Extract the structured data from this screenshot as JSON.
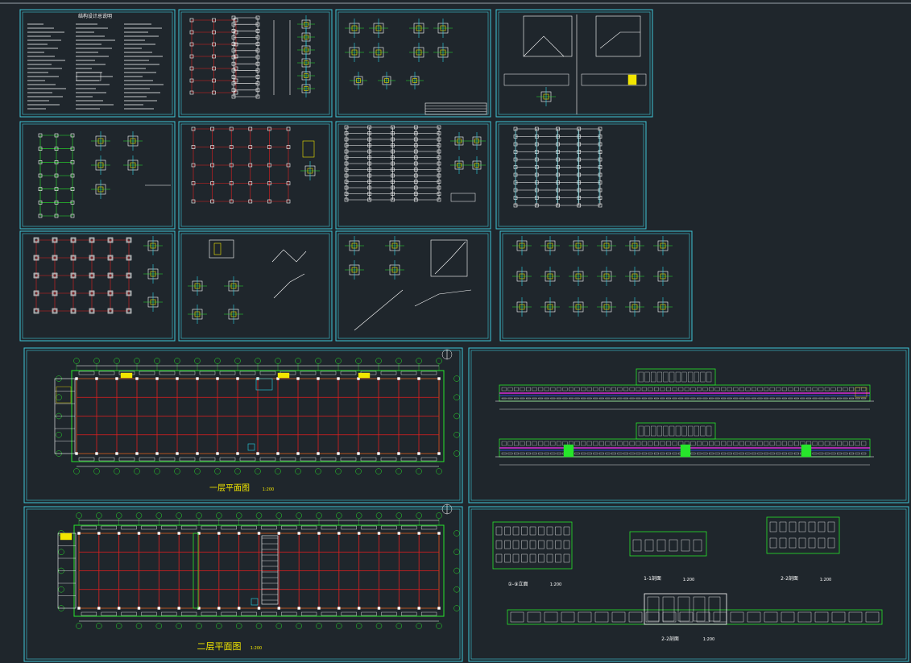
{
  "sheets": [
    {
      "id": "notes",
      "kind": "notes",
      "title": "结构设计总说明"
    },
    {
      "id": "s2",
      "kind": "framing"
    },
    {
      "id": "s3",
      "kind": "details"
    },
    {
      "id": "s4",
      "kind": "stair-sections"
    },
    {
      "id": "s5",
      "kind": "foundation"
    },
    {
      "id": "s6",
      "kind": "grid-plan"
    },
    {
      "id": "s7",
      "kind": "slab-plan"
    },
    {
      "id": "s8",
      "kind": "roof-plan"
    },
    {
      "id": "s9",
      "kind": "column-plan"
    },
    {
      "id": "s10",
      "kind": "stair-detail"
    },
    {
      "id": "s11",
      "kind": "stair-detail-2"
    },
    {
      "id": "s12",
      "kind": "node-details"
    },
    {
      "id": "plan1",
      "kind": "floor-plan",
      "caption": "一层平面图",
      "scale": "1:200"
    },
    {
      "id": "elev",
      "kind": "elevations"
    },
    {
      "id": "plan2",
      "kind": "floor-plan",
      "caption": "二层平面图",
      "scale": "1:200"
    },
    {
      "id": "sect",
      "kind": "sections",
      "labels": [
        "①-⑨立面",
        "1-1剖面",
        "2-2剖面",
        "2-2剖面"
      ],
      "scale": "1:200"
    }
  ],
  "colors": {
    "background": "#1f262c",
    "frame": "#3fc6d8",
    "grid": "#e21f1f",
    "line": "#27e52b",
    "white": "#ffffff",
    "yellow": "#f2e600",
    "magenta": "#d82bd8",
    "blue": "#2f4cff",
    "cyan": "#28d6e6"
  }
}
